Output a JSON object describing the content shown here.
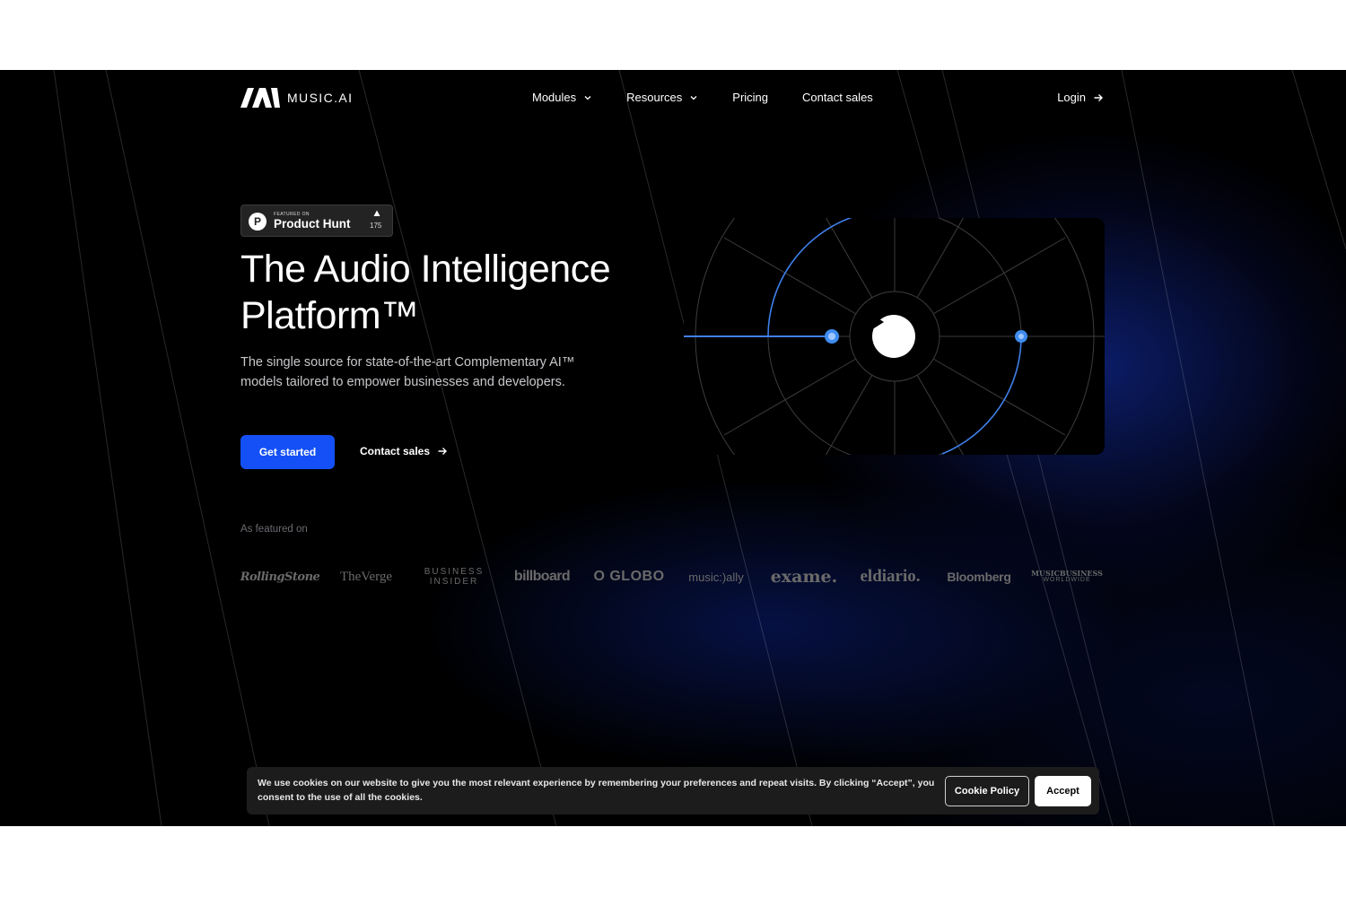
{
  "nav": {
    "logo_text": "MUSIC.AI",
    "links": [
      {
        "label": "Modules",
        "has_dropdown": true
      },
      {
        "label": "Resources",
        "has_dropdown": true
      },
      {
        "label": "Pricing",
        "has_dropdown": false
      },
      {
        "label": "Contact sales",
        "has_dropdown": false
      }
    ],
    "login_label": "Login"
  },
  "badge": {
    "small_text": "FEATURED ON",
    "name": "Product Hunt",
    "count": "175",
    "icon": "product-hunt-icon"
  },
  "hero": {
    "title": "The Audio Intelligence Platform™",
    "description": "The single source for state-of-the-art Complementary AI™ models tailored to empower businesses and developers.",
    "primary_cta": "Get started",
    "secondary_cta": "Contact sales"
  },
  "video": {
    "play_icon": "play-icon"
  },
  "featured": {
    "label": "As featured on",
    "logos": {
      "rolling_stone": "RollingStone",
      "the_verge": "TheVerge",
      "business_insider_1": "BUSINESS",
      "business_insider_2": "INSIDER",
      "billboard": "billboard",
      "o_globo": "O GLOBO",
      "music_ally": "music:)ally",
      "exame": "exame.",
      "eldiario": "eldiario.",
      "bloomberg": "Bloomberg",
      "music_business_1": "MUSICBUSINESS",
      "music_business_2": "WORLDWIDE"
    }
  },
  "cookie": {
    "text": "We use cookies on our website to give you the most relevant experience by remembering your preferences and repeat visits. By clicking “Accept”, you consent to the use of all the cookies.",
    "policy_label": "Cookie Policy",
    "accept_label": "Accept"
  },
  "colors": {
    "background": "#000000",
    "accent": "#1450F5",
    "glow": "#1534BE",
    "cookie_bg": "#1C1C1C"
  }
}
